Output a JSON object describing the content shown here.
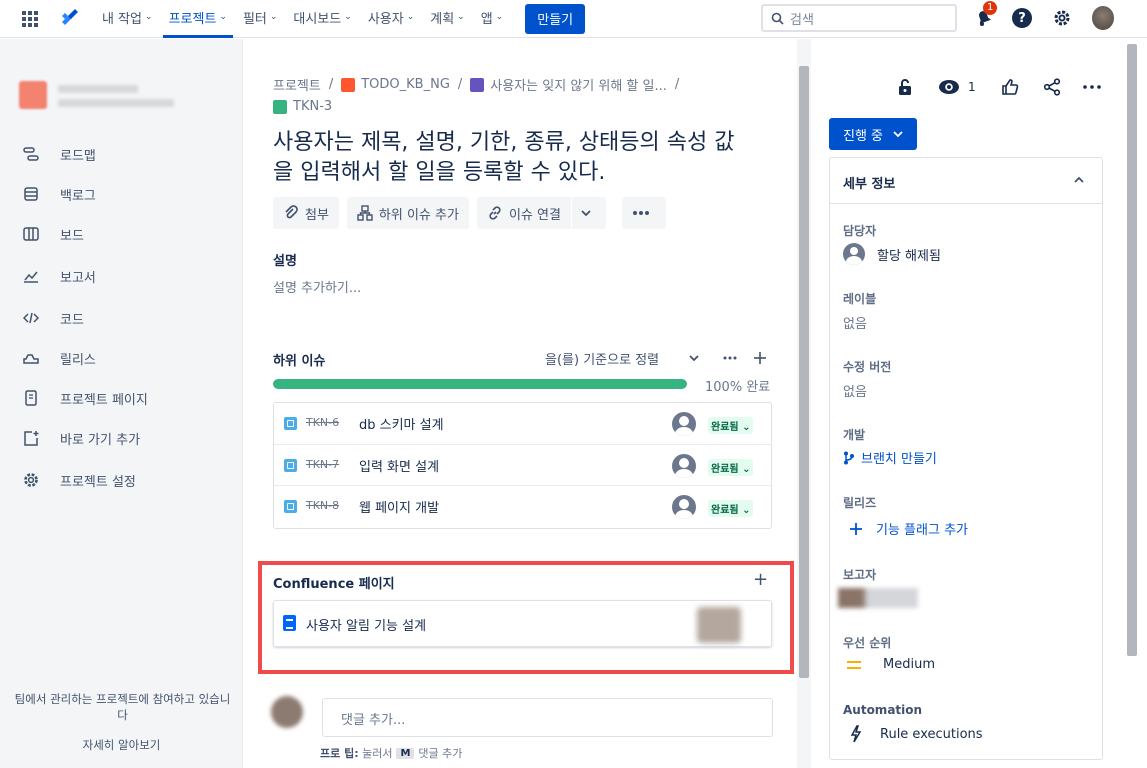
{
  "nav": {
    "items": [
      {
        "label": "내 작업",
        "active": false
      },
      {
        "label": "프로젝트",
        "active": true
      },
      {
        "label": "필터",
        "active": false
      },
      {
        "label": "대시보드",
        "active": false
      },
      {
        "label": "사용자",
        "active": false
      },
      {
        "label": "계획",
        "active": false
      },
      {
        "label": "앱",
        "active": false
      }
    ],
    "create_label": "만들기",
    "search_placeholder": "검색",
    "notification_count": "1",
    "help_label": "?"
  },
  "sidebar": {
    "items": [
      {
        "label": "로드맵",
        "icon": "roadmap-icon"
      },
      {
        "label": "백로그",
        "icon": "backlog-icon"
      },
      {
        "label": "보드",
        "icon": "board-icon"
      },
      {
        "label": "보고서",
        "icon": "reports-icon"
      },
      {
        "label": "코드",
        "icon": "code-icon"
      },
      {
        "label": "릴리스",
        "icon": "releases-icon"
      },
      {
        "label": "프로젝트 페이지",
        "icon": "project-pages-icon"
      },
      {
        "label": "바로 가기 추가",
        "icon": "add-shortcut-icon"
      },
      {
        "label": "프로젝트 설정",
        "icon": "settings-icon"
      }
    ],
    "footer_text": "팀에서 관리하는 프로젝트에 참여하고 있습니다",
    "learn_more": "자세히 알아보기"
  },
  "breadcrumb": {
    "root": "프로젝트",
    "project": "TODO_KB_NG",
    "epic": "사용자는 잊지 않기 위해 할 일...",
    "issue_key": "TKN-3"
  },
  "issue": {
    "title": "사용자는 제목, 설명, 기한, 종류, 상태등의 속성 값을 입력해서 할 일을 등록할 수 있다.",
    "actions": {
      "attach": "첨부",
      "add_child": "하위 이슈 추가",
      "link_issue": "이슈 연결"
    },
    "description_label": "설명",
    "description_placeholder": "설명 추가하기..."
  },
  "child_issues": {
    "label": "하위 이슈",
    "sort_label": "을(를) 기준으로 정렬",
    "progress_percent": 100,
    "progress_label": "100% 완료",
    "items": [
      {
        "key": "TKN-6",
        "summary": "db 스키마 설계",
        "status": "완료됨"
      },
      {
        "key": "TKN-7",
        "summary": "입력 화면 설계",
        "status": "완료됨"
      },
      {
        "key": "TKN-8",
        "summary": "웹 페이지 개발",
        "status": "완료됨"
      }
    ]
  },
  "confluence": {
    "label": "Confluence 페이지",
    "page_title": "사용자 알림 기능 설계"
  },
  "comment": {
    "placeholder": "댓글 추가...",
    "tip_prefix": "프로 팁:",
    "tip_mid": "눌러서",
    "tip_key": "M",
    "tip_suffix": "댓글 추가"
  },
  "right": {
    "watch_count": "1",
    "status_label": "진행 중",
    "details_title": "세부 정보",
    "fields": {
      "assignee_label": "담당자",
      "assignee_value": "할당 해제됨",
      "labels_label": "레이블",
      "labels_value": "없음",
      "fix_version_label": "수정 버전",
      "fix_version_value": "없음",
      "development_label": "개발",
      "development_value": "브랜치 만들기",
      "releases_label": "릴리즈",
      "releases_value": "기능 플래그 추가",
      "reporter_label": "보고자",
      "priority_label": "우선 순위",
      "priority_value": "Medium",
      "automation_label": "Automation",
      "automation_value": "Rule executions"
    }
  },
  "colors": {
    "brand": "#0052cc",
    "done_green": "#36b37e",
    "highlight_red": "#ef4b4b",
    "priority_medium": "#ffab00"
  }
}
